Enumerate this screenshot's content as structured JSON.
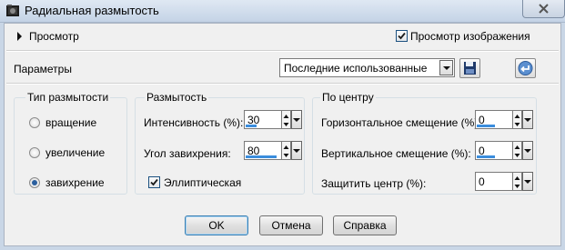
{
  "window": {
    "title": "Радиальная размытость"
  },
  "preview": {
    "label": "Просмотр",
    "image_preview_label": "Просмотр изображения",
    "image_preview_checked": true
  },
  "params": {
    "label": "Параметры",
    "preset_value": "Последние использованные"
  },
  "blur_type": {
    "title": "Тип размытости",
    "options": [
      "вращение",
      "увеличение",
      "завихрение"
    ],
    "selected": "завихрение"
  },
  "blur": {
    "title": "Размытость",
    "intensity_label": "Интенсивность (%):",
    "intensity_value": "30",
    "twist_label": "Угол завихрения:",
    "twist_value": "80",
    "elliptical_label": "Эллиптическая",
    "elliptical_checked": true
  },
  "center": {
    "title": "По центру",
    "h_offset_label": "Горизонтальное смещение (%):",
    "h_offset_value": "0",
    "v_offset_label": "Вертикальное смещение (%):",
    "v_offset_value": "0",
    "protect_label": "Защитить центр (%):",
    "protect_value": "0"
  },
  "buttons": {
    "ok": "OK",
    "cancel": "Отмена",
    "help": "Справка"
  },
  "colors": {
    "accent": "#3b8ddd",
    "radio_dot": "#2b5f9e",
    "titlebar": "#c4d3e6"
  }
}
